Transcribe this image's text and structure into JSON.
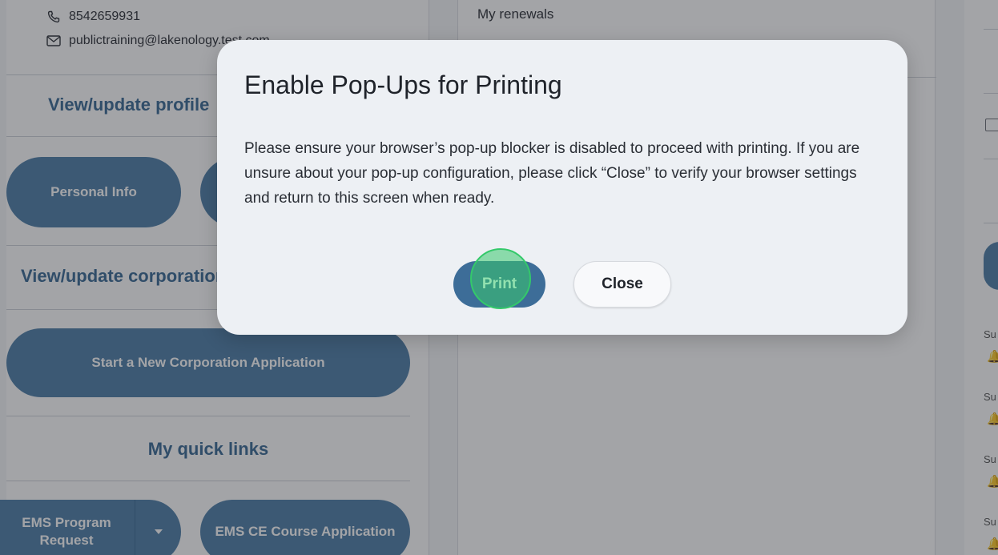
{
  "contact": {
    "phone": "8542659931",
    "email": "publictraining@lakenology.test.com"
  },
  "left_panel": {
    "profile_title": "View/update profile",
    "personal_info_label": "Personal Info",
    "corporation_title": "View/update corporation",
    "start_corp_label": "Start a New Corporation Application",
    "quick_links_title": "My quick links",
    "ems_program_label": "EMS Program Request",
    "ems_ce_label": "EMS CE Course Application"
  },
  "middle_panel": {
    "heading": "My renewals"
  },
  "right_panel": {
    "items": [
      {
        "label": "Su"
      },
      {
        "label": "Su"
      },
      {
        "label": "Su"
      },
      {
        "label": "Su"
      }
    ]
  },
  "modal": {
    "title": "Enable Pop-Ups for Printing",
    "body": "Please ensure your browser’s pop-up blocker is disabled to proceed with printing. If you are unsure about your pop-up configuration, please click “Close” to verify your browser settings and return to this screen when ready.",
    "print_label": "Print",
    "close_label": "Close"
  },
  "colors": {
    "accent": "#4f7fa8",
    "overlay": "rgba(35,38,45,0.42)",
    "click_indicator": "#34c96a",
    "alert_bell": "#d23b3b"
  },
  "icons": [
    "phone-icon",
    "mail-icon",
    "chevron-down-icon",
    "bell-icon",
    "add-document-icon"
  ]
}
